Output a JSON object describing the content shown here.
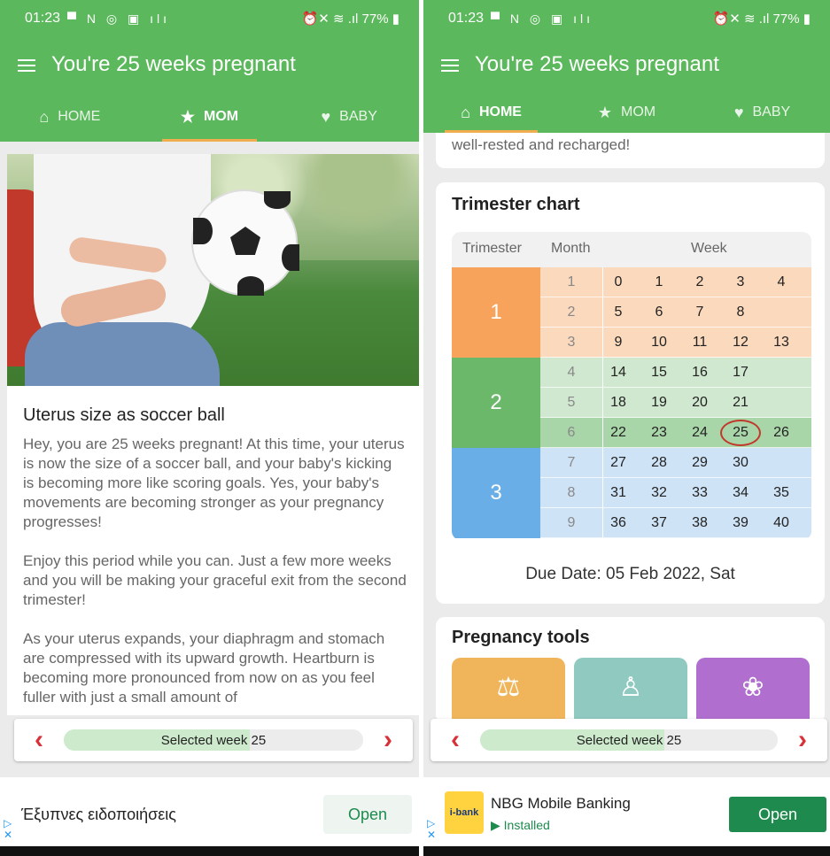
{
  "left": {
    "status": {
      "time": "01:23",
      "icons": "▀ N ◎ ▣ ılı",
      "right": "⏰✕ ≋ .ıl 77% ▮"
    },
    "appbar_title": "You're 25 weeks pregnant",
    "tabs": [
      {
        "label": "HOME",
        "icon": "home-icon"
      },
      {
        "label": "MOM",
        "icon": "star-icon"
      },
      {
        "label": "BABY",
        "icon": "heart-icon"
      }
    ],
    "article": {
      "title": "Uterus size as soccer ball",
      "paragraphs": [
        "Hey, you are 25 weeks pregnant! At this time, your uterus is now the size of a soccer ball, and your baby's kicking is becoming more like scoring goals. Yes, your baby's movements are becoming stronger as your pregnancy progresses!",
        "Enjoy this period while you can. Just a few more weeks and you will be making your graceful exit from the second trimester!",
        "As your uterus expands, your diaphragm and stomach are compressed with its upward growth. Heartburn is becoming more pronounced from now on as you feel fuller with just a small amount of"
      ]
    },
    "selected_week_label": "Selected week 25",
    "ad": {
      "text": "Έξυπνες ειδοποιήσεις",
      "button": "Open"
    }
  },
  "right": {
    "status": {
      "time": "01:23",
      "icons": "▀ N ◎ ▣ ılı",
      "right": "⏰✕ ≋ .ıl 77% ▮"
    },
    "appbar_title": "You're 25 weeks pregnant",
    "tabs": [
      {
        "label": "HOME",
        "icon": "home-icon"
      },
      {
        "label": "MOM",
        "icon": "star-icon"
      },
      {
        "label": "BABY",
        "icon": "heart-icon"
      }
    ],
    "scrolled_text": "well-rested and recharged!",
    "chart": {
      "title": "Trimester chart",
      "headers": {
        "trimester": "Trimester",
        "month": "Month",
        "week": "Week"
      },
      "colors": {
        "t1_dark": "#f7a35c",
        "t1_light": "#fbd9bd",
        "t2_dark": "#6bb86b",
        "t2_light": "#cfe8cf",
        "t3_dark": "#6aaee8",
        "t3_light": "#cfe3f7",
        "selected_row": "#a9d6a9"
      },
      "trimesters": [
        {
          "label": "1",
          "months": [
            {
              "month": "1",
              "weeks": [
                "0",
                "1",
                "2",
                "3",
                "4"
              ]
            },
            {
              "month": "2",
              "weeks": [
                "5",
                "6",
                "7",
                "8"
              ]
            },
            {
              "month": "3",
              "weeks": [
                "9",
                "10",
                "11",
                "12",
                "13"
              ]
            }
          ]
        },
        {
          "label": "2",
          "months": [
            {
              "month": "4",
              "weeks": [
                "14",
                "15",
                "16",
                "17"
              ]
            },
            {
              "month": "5",
              "weeks": [
                "18",
                "19",
                "20",
                "21"
              ]
            },
            {
              "month": "6",
              "weeks": [
                "22",
                "23",
                "24",
                "25",
                "26"
              ]
            }
          ]
        },
        {
          "label": "3",
          "months": [
            {
              "month": "7",
              "weeks": [
                "27",
                "28",
                "29",
                "30"
              ]
            },
            {
              "month": "8",
              "weeks": [
                "31",
                "32",
                "33",
                "34",
                "35"
              ]
            },
            {
              "month": "9",
              "weeks": [
                "36",
                "37",
                "38",
                "39",
                "40"
              ]
            }
          ]
        }
      ],
      "current_week": "25",
      "due_date": "Due Date: 05 Feb 2022, Sat"
    },
    "tools": {
      "title": "Pregnancy tools",
      "items": [
        {
          "icon": "scale-icon",
          "color": "#f0b55a"
        },
        {
          "icon": "yoga-icon",
          "color": "#8fc9c0"
        },
        {
          "icon": "footprints-icon",
          "color": "#b06fcf"
        }
      ]
    },
    "selected_week_label": "Selected week 25",
    "ad": {
      "logo": "i-bank",
      "name": "NBG Mobile Banking",
      "sub": "Installed",
      "button": "Open"
    }
  }
}
